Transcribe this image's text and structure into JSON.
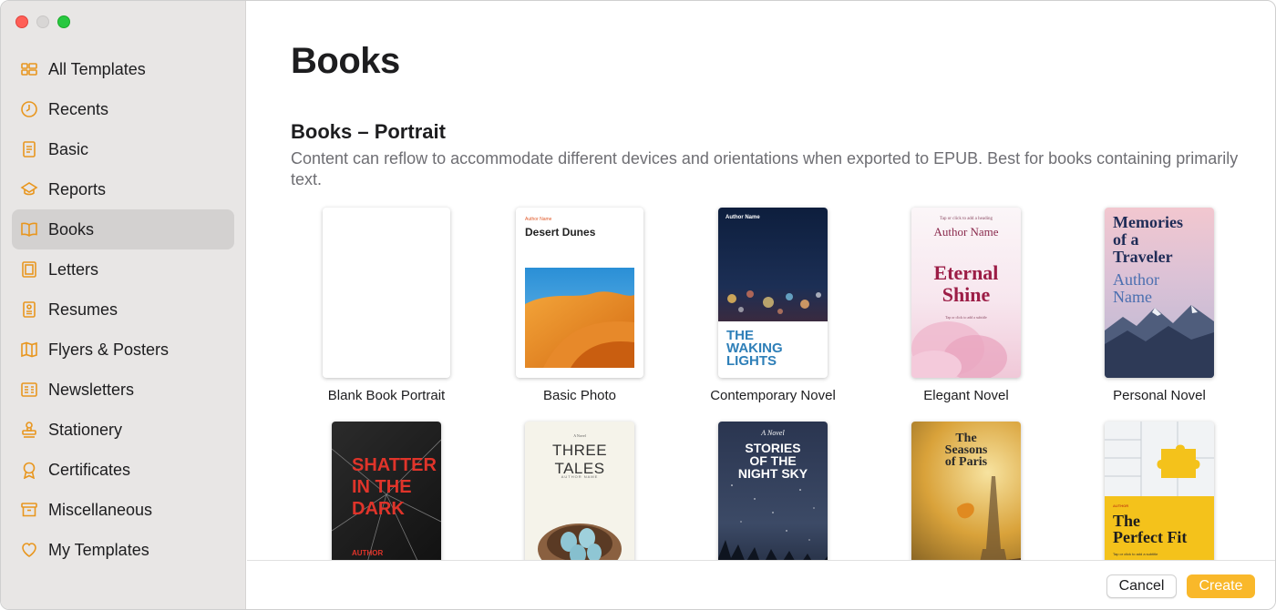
{
  "sidebar": {
    "items": [
      {
        "label": "All Templates",
        "icon": "all-templates-icon"
      },
      {
        "label": "Recents",
        "icon": "clock-icon"
      },
      {
        "label": "Basic",
        "icon": "document-icon"
      },
      {
        "label": "Reports",
        "icon": "reports-icon"
      },
      {
        "label": "Books",
        "icon": "book-icon",
        "active": true
      },
      {
        "label": "Letters",
        "icon": "letter-icon"
      },
      {
        "label": "Resumes",
        "icon": "resume-icon"
      },
      {
        "label": "Flyers & Posters",
        "icon": "map-icon"
      },
      {
        "label": "Newsletters",
        "icon": "newsletter-icon"
      },
      {
        "label": "Stationery",
        "icon": "stamp-icon"
      },
      {
        "label": "Certificates",
        "icon": "ribbon-icon"
      },
      {
        "label": "Miscellaneous",
        "icon": "archive-icon"
      },
      {
        "label": "My Templates",
        "icon": "heart-icon"
      }
    ]
  },
  "main": {
    "title": "Books",
    "section_title": "Books – Portrait",
    "section_desc": "Content can reflow to accommodate different devices and orientations when exported to EPUB. Best for books containing primarily text.",
    "templates": [
      {
        "label": "Blank Book Portrait"
      },
      {
        "label": "Basic Photo",
        "cover": {
          "author": "Author Name",
          "title": "Desert Dunes"
        }
      },
      {
        "label": "Contemporary Novel",
        "cover": {
          "author": "Author Name",
          "title_lines": [
            "THE",
            "WAKING",
            "LIGHTS"
          ]
        }
      },
      {
        "label": "Elegant Novel",
        "cover": {
          "heading_hint": "Tap or click to add a heading",
          "author": "Author Name",
          "title_lines": [
            "Eternal",
            "Shine"
          ],
          "subtitle_hint": "Tap or click to add a subtitle"
        }
      },
      {
        "label": "Personal Novel",
        "cover": {
          "title_lines": [
            "Memories",
            "of a",
            "Traveler"
          ],
          "author_lines": [
            "Author",
            "Name"
          ]
        }
      },
      {
        "label": "",
        "cover": {
          "title_lines": [
            "SHATTER",
            "IN THE",
            "DARK"
          ],
          "author": "AUTHOR"
        }
      },
      {
        "label": "",
        "cover": {
          "kicker": "A Novel",
          "title": "THREE TALES",
          "author": "AUTHOR NAME"
        }
      },
      {
        "label": "",
        "cover": {
          "kicker": "A Novel",
          "title_lines": [
            "STORIES",
            "OF THE",
            "NIGHT SKY"
          ]
        }
      },
      {
        "label": "",
        "cover": {
          "title_lines": [
            "The",
            "Seasons",
            "of Paris"
          ]
        }
      },
      {
        "label": "",
        "cover": {
          "kicker": "AUTHOR",
          "title_lines": [
            "The",
            "Perfect Fit"
          ],
          "subtitle_hint": "Tap or click to add a subtitle"
        }
      }
    ]
  },
  "footer": {
    "cancel_label": "Cancel",
    "create_label": "Create"
  },
  "colors": {
    "accent": "#f9b82a",
    "sidebar_icon": "#e8961e",
    "sidebar_bg": "#e8e6e5",
    "selected_row": "#d3d1d0"
  }
}
